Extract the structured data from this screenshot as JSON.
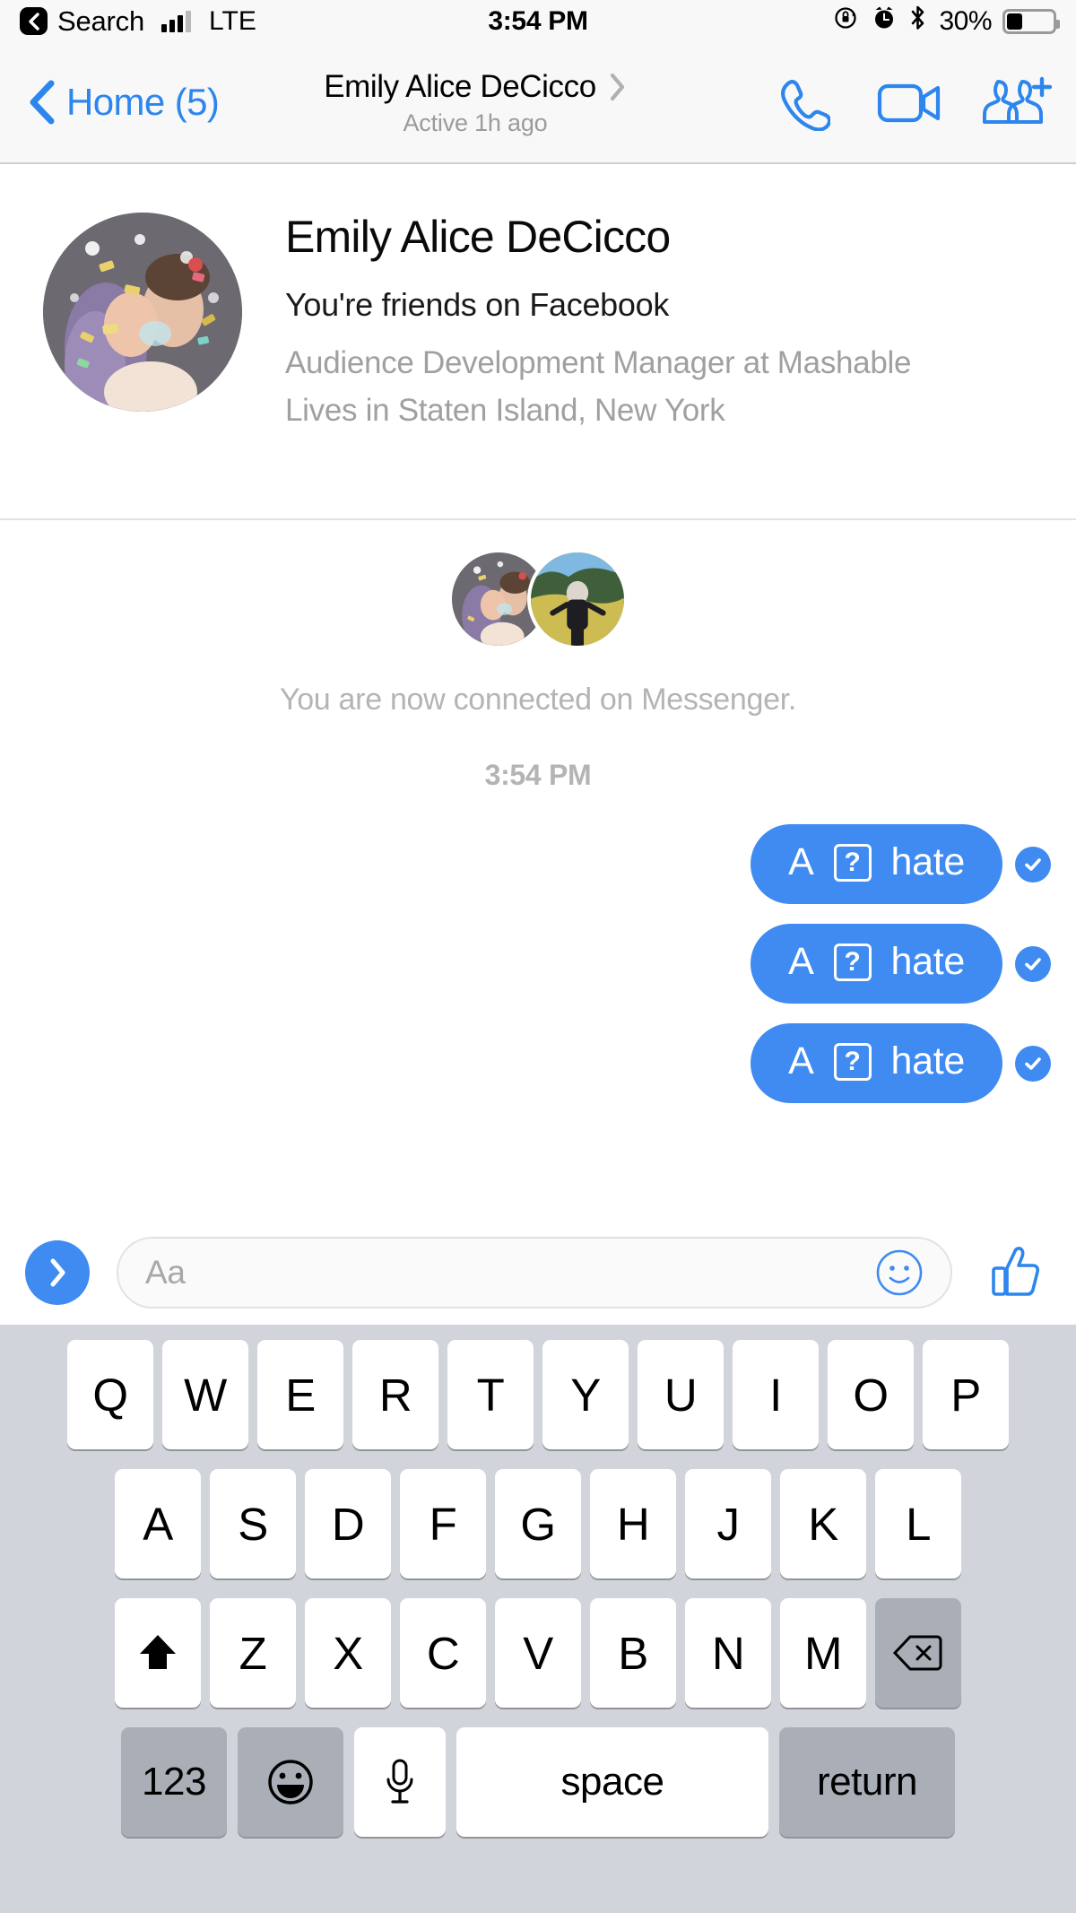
{
  "status_bar": {
    "back_app_label": "Search",
    "carrier": "LTE",
    "time": "3:54 PM",
    "battery_percent": "30%",
    "icons": [
      "back-chevron-icon",
      "signal-bars-icon",
      "rotation-lock-icon",
      "alarm-clock-icon",
      "bluetooth-icon",
      "battery-icon"
    ],
    "battery_fill_ratio": 0.34
  },
  "nav_bar": {
    "back_label": "Home (5)",
    "title": "Emily Alice DeCicco",
    "subtitle": "Active 1h ago",
    "actions": [
      "phone-call-icon",
      "video-camera-icon",
      "add-people-icon"
    ],
    "accent_color": "#2d86ed"
  },
  "profile": {
    "name": "Emily Alice DeCicco",
    "relationship": "You're friends on Facebook",
    "work": "Audience Development Manager at Mashable",
    "location": "Lives in Staten Island, New York"
  },
  "thread": {
    "connected_text": "You are now connected on Messenger.",
    "timestamp": "3:54 PM",
    "messages": [
      {
        "prefix": "A",
        "glyph": "?",
        "text": "hate",
        "status": "delivered-check-icon"
      },
      {
        "prefix": "A",
        "glyph": "?",
        "text": "hate",
        "status": "delivered-check-icon"
      },
      {
        "prefix": "A",
        "glyph": "?",
        "text": "hate",
        "status": "delivered-check-icon"
      }
    ],
    "bubble_color": "#3f8bf2",
    "muted_text_color": "#b4b4b4"
  },
  "composer": {
    "send_icon": "chevron-right-icon",
    "placeholder": "Aa",
    "value": "",
    "emoji_icon": "smiley-face-icon",
    "like_icon": "thumbs-up-icon"
  },
  "keyboard": {
    "row1": [
      "Q",
      "W",
      "E",
      "R",
      "T",
      "Y",
      "U",
      "I",
      "O",
      "P"
    ],
    "row2": [
      "A",
      "S",
      "D",
      "F",
      "G",
      "H",
      "J",
      "K",
      "L"
    ],
    "row3": [
      "Z",
      "X",
      "C",
      "V",
      "B",
      "N",
      "M"
    ],
    "shift_label": "shift-arrow-icon",
    "delete_label": "backspace-icon",
    "numbers_label": "123",
    "emoji_label": "emoji-face-icon",
    "mic_label": "microphone-icon",
    "space_label": "space",
    "return_label": "return",
    "bg_color": "#d1d4da",
    "key_color": "#ffffff",
    "fn_key_color": "#a9aeb7"
  }
}
